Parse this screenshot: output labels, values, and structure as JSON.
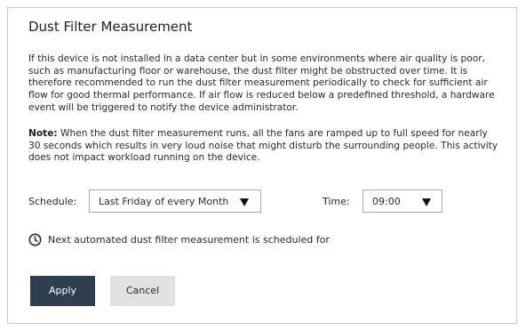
{
  "dialog": {
    "title": "Dust Filter Measurement",
    "description": "If this device is not installed in a data center but in some environments where air quality is poor, such as manufacturing floor or warehouse, the dust filter might be obstructed over time. It is therefore recommended to run the dust filter measurement periodically to check for sufficient air flow for good thermal performance. If air flow is reduced below a predefined threshold, a hardware event will be triggered to notify the device administrator.",
    "note_label": "Note:",
    "note_text": "When the dust filter measurement runs, all the fans are ramped up to full speed for nearly 30 seconds which results in very loud noise that might disturb the surrounding people. This activity does not impact workload running on the device."
  },
  "schedule": {
    "label": "Schedule:",
    "selected": "Last Friday of every Month",
    "arrow_icon": "caret-down-icon"
  },
  "time": {
    "label": "Time:",
    "selected": "09:00",
    "arrow_icon": "caret-down-icon"
  },
  "info": {
    "icon": "clock-icon",
    "text": "Next automated dust filter measurement is scheduled for"
  },
  "buttons": {
    "apply_label": "Apply",
    "cancel_label": "Cancel"
  },
  "colors": {
    "apply_bg": "#2c3e50",
    "cancel_bg": "#e1e1e1",
    "border": "#c8c8c8"
  }
}
